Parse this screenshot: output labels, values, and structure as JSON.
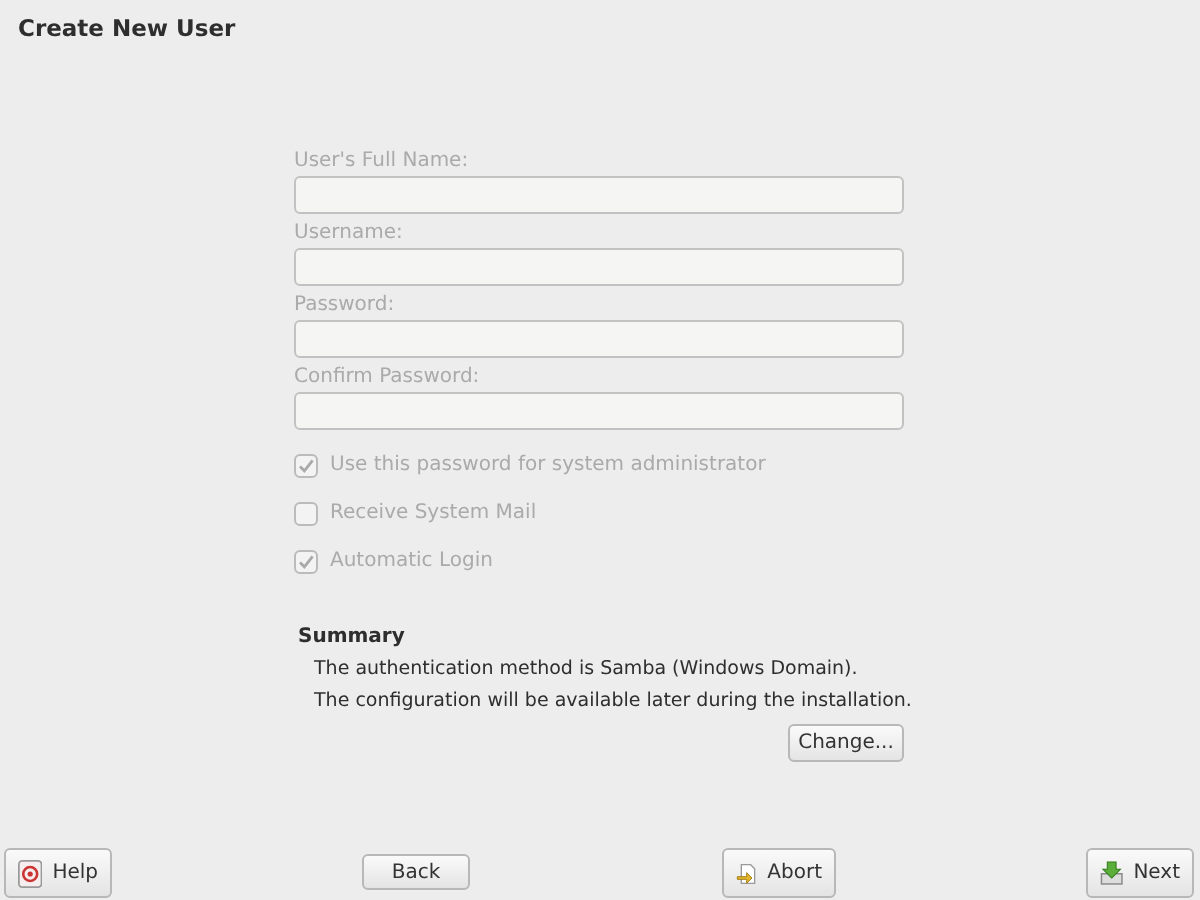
{
  "window": {
    "title": "Create New User"
  },
  "fields": [
    {
      "label": "User's Full Name:",
      "disabled": true
    },
    {
      "label": "Username:",
      "disabled": true
    },
    {
      "label": "Password:",
      "disabled": true
    },
    {
      "label": "Confirm Password:",
      "disabled": true
    }
  ],
  "options": [
    {
      "label": "Use this password for system administrator",
      "checked": true,
      "disabled": true
    },
    {
      "label": "Receive System Mail",
      "checked": false,
      "disabled": true
    },
    {
      "label": "Automatic Login",
      "checked": true,
      "disabled": true
    }
  ],
  "summary": {
    "title": "Summary",
    "lines": [
      "The authentication method is Samba (Windows Domain).",
      "The configuration will be available later during the installation."
    ],
    "button": "Change..."
  },
  "buttons": [
    {
      "label": "Help",
      "kind": "help"
    },
    {
      "label": "Back",
      "kind": "back"
    },
    {
      "label": "Abort",
      "kind": "abort"
    },
    {
      "label": "Next",
      "kind": "next"
    }
  ]
}
